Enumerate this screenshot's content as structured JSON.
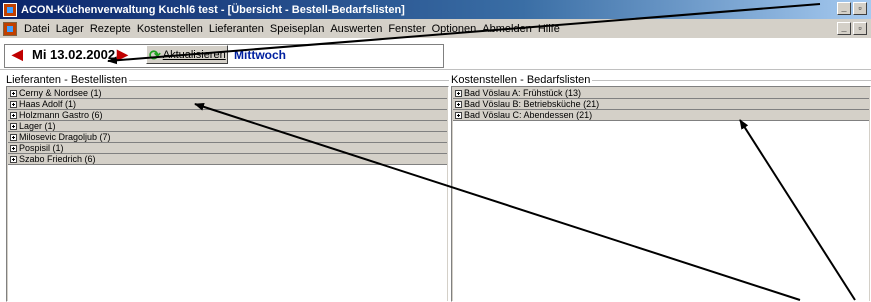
{
  "window": {
    "title": "ACON-Küchenverwaltung Kuchl6 test - [Übersicht - Bestell-Bedarfslisten]"
  },
  "menu": {
    "items": [
      "Datei",
      "Lager",
      "Rezepte",
      "Kostenstellen",
      "Lieferanten",
      "Speiseplan",
      "Auswerten",
      "Fenster",
      "Optionen",
      "Abmelden",
      "Hilfe"
    ]
  },
  "toolbar": {
    "date": "Mi 13.02.2002",
    "refresh_label": "Aktualisieren",
    "weekday": "Mittwoch"
  },
  "left_panel": {
    "caption": "Lieferanten - Bestellisten",
    "rows": [
      "Cerny & Nordsee  (1)",
      "Haas Adolf  (1)",
      "Holzmann Gastro  (6)",
      "Lager  (1)",
      "Milosevic Dragoljub  (7)",
      "Pospisil  (1)",
      "Szabo Friedrich  (6)"
    ]
  },
  "right_panel": {
    "caption": "Kostenstellen - Bedarfslisten",
    "rows": [
      "Bad Vöslau A: Frühstück  (13)",
      "Bad Vöslau B: Betriebsküche  (21)",
      "Bad Vöslau C: Abendessen  (21)"
    ]
  },
  "colors": {
    "title_bar": "#0a246a",
    "face": "#d4d0c8",
    "accent_arrow": "#c00000",
    "weekday_text": "#0020a0"
  }
}
